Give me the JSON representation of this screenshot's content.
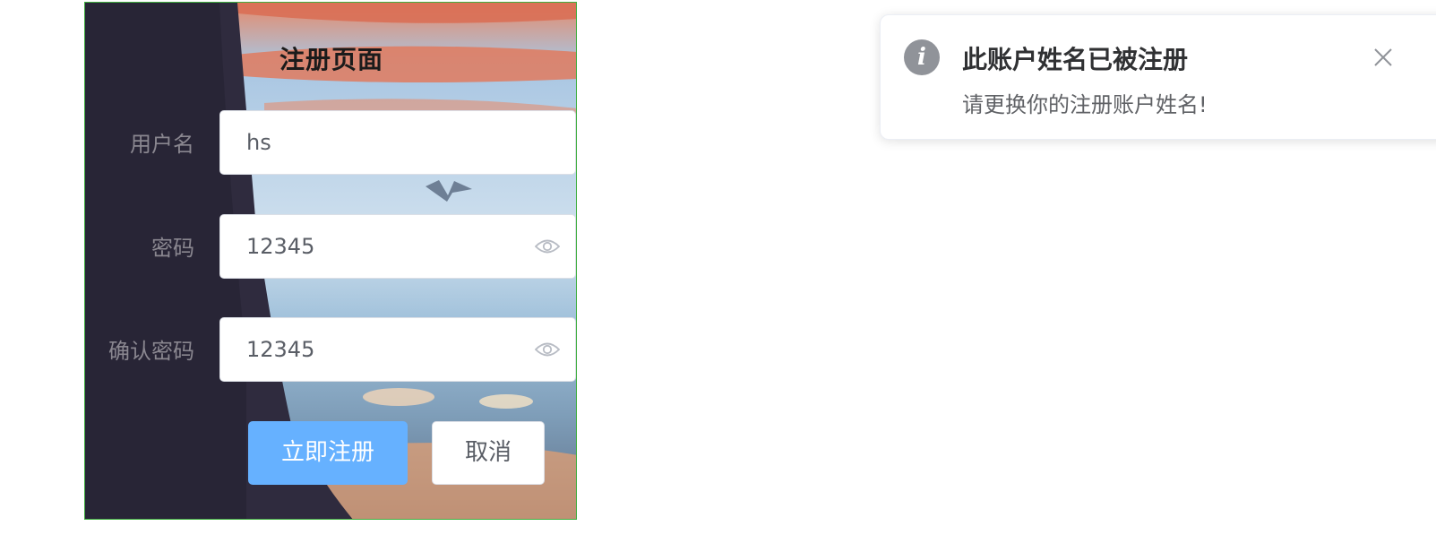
{
  "form": {
    "title": "注册页面",
    "fields": [
      {
        "label": "用户名",
        "value": "hs"
      },
      {
        "label": "密码",
        "value": "12345",
        "icon": "eye-icon"
      },
      {
        "label": "确认密码",
        "value": "12345",
        "icon": "eye-icon"
      }
    ],
    "submit_label": "立即注册",
    "cancel_label": "取消"
  },
  "notification": {
    "icon": "info-icon",
    "title": "此账户姓名已被注册",
    "message": "请更换你的注册账户姓名!",
    "close_icon": "close-icon"
  },
  "colors": {
    "primary": "#66b1ff",
    "info": "#909399",
    "panel_border": "#3fae3f"
  }
}
